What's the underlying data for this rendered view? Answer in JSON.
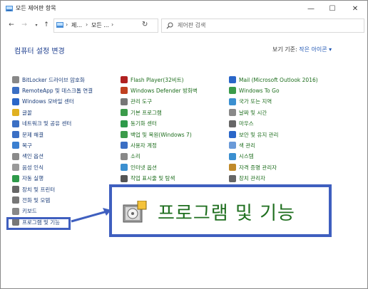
{
  "window": {
    "title": "모든 제어판 항목",
    "controls": {
      "minimize": "—",
      "maximize": "☐",
      "close": "✕"
    }
  },
  "address": {
    "crumbs": [
      "제...",
      "모든 ..."
    ],
    "separator": "›",
    "search_placeholder": "제어판 검색"
  },
  "main": {
    "title": "컴퓨터 설정 변경",
    "view_by_label": "보기 기준:",
    "view_by_value": "작은 아이콘 ▾"
  },
  "columns": [
    [
      {
        "label": "BitLocker 드라이브 암호화",
        "icon": "bitlocker-icon",
        "color": "#888888"
      },
      {
        "label": "RemoteApp 및 데스크톱 연결",
        "icon": "remoteapp-icon",
        "color": "#3b6fc4"
      },
      {
        "label": "Windows 모바일 센터",
        "icon": "mobility-center-icon",
        "color": "#2a66c8"
      },
      {
        "label": "글꼴",
        "icon": "fonts-icon",
        "color": "#e0b020"
      },
      {
        "label": "네트워크 및 공유 센터",
        "icon": "network-icon",
        "color": "#3b6fc4"
      },
      {
        "label": "문제 해결",
        "icon": "troubleshooting-icon",
        "color": "#3b6fc4"
      },
      {
        "label": "복구",
        "icon": "recovery-icon",
        "color": "#3b7fd0"
      },
      {
        "label": "색인 옵션",
        "icon": "indexing-icon",
        "color": "#8a8a8a"
      },
      {
        "label": "음성 인식",
        "icon": "speech-icon",
        "color": "#999999"
      },
      {
        "label": "자동 실행",
        "icon": "autoplay-icon",
        "color": "#2e9a4a"
      },
      {
        "label": "장치 및 프린터",
        "icon": "printer-icon",
        "color": "#666666"
      },
      {
        "label": "전화 및 모뎀",
        "icon": "phone-modem-icon",
        "color": "#777777"
      },
      {
        "label": "키보드",
        "icon": "keyboard-icon",
        "color": "#888888"
      },
      {
        "label": "프로그램 및 기능",
        "icon": "programs-features-icon",
        "color": "#777777"
      }
    ],
    [
      {
        "label": "Flash Player(32비트)",
        "icon": "flash-icon",
        "color": "#b02020"
      },
      {
        "label": "Windows Defender 방화벽",
        "icon": "firewall-icon",
        "color": "#c04020"
      },
      {
        "label": "관리 도구",
        "icon": "admin-tools-icon",
        "color": "#777777"
      },
      {
        "label": "기본 프로그램",
        "icon": "default-programs-icon",
        "color": "#3b9b4a"
      },
      {
        "label": "동기화 센터",
        "icon": "sync-center-icon",
        "color": "#2e9a4a"
      },
      {
        "label": "백업 및 복원(Windows 7)",
        "icon": "backup-icon",
        "color": "#3b9b4a"
      },
      {
        "label": "사용자 계정",
        "icon": "user-accounts-icon",
        "color": "#3b6fc4"
      },
      {
        "label": "소리",
        "icon": "sound-icon",
        "color": "#888888"
      },
      {
        "label": "인터넷 옵션",
        "icon": "internet-options-icon",
        "color": "#3b8fd0"
      },
      {
        "label": "작업 표시줄 및 탐색",
        "icon": "taskbar-icon",
        "color": "#555555"
      }
    ],
    [
      {
        "label": "Mail (Microsoft Outlook 2016)",
        "icon": "mail-icon",
        "color": "#2a66c8"
      },
      {
        "label": "Windows To Go",
        "icon": "windows-to-go-icon",
        "color": "#3b9b4a"
      },
      {
        "label": "국가 또는 지역",
        "icon": "region-icon",
        "color": "#3b8fd0"
      },
      {
        "label": "날짜 및 시간",
        "icon": "date-time-icon",
        "color": "#888888"
      },
      {
        "label": "마우스",
        "icon": "mouse-icon",
        "color": "#666666"
      },
      {
        "label": "보안 및 유지 관리",
        "icon": "security-maintenance-icon",
        "color": "#2a66c8"
      },
      {
        "label": "색 관리",
        "icon": "color-management-icon",
        "color": "#6a9ad8"
      },
      {
        "label": "시스템",
        "icon": "system-icon",
        "color": "#3b8fd0"
      },
      {
        "label": "자격 증명 관리자",
        "icon": "credential-manager-icon",
        "color": "#c08a2a"
      },
      {
        "label": "장치 관리자",
        "icon": "device-manager-icon",
        "color": "#666666"
      }
    ]
  ],
  "callout": {
    "label": "프로그램 및 기능"
  },
  "colors": {
    "accent": "#3f5fbf",
    "title": "#1e3f8f",
    "link": "#1b3d7a",
    "callout_text": "#1e6e1e"
  }
}
